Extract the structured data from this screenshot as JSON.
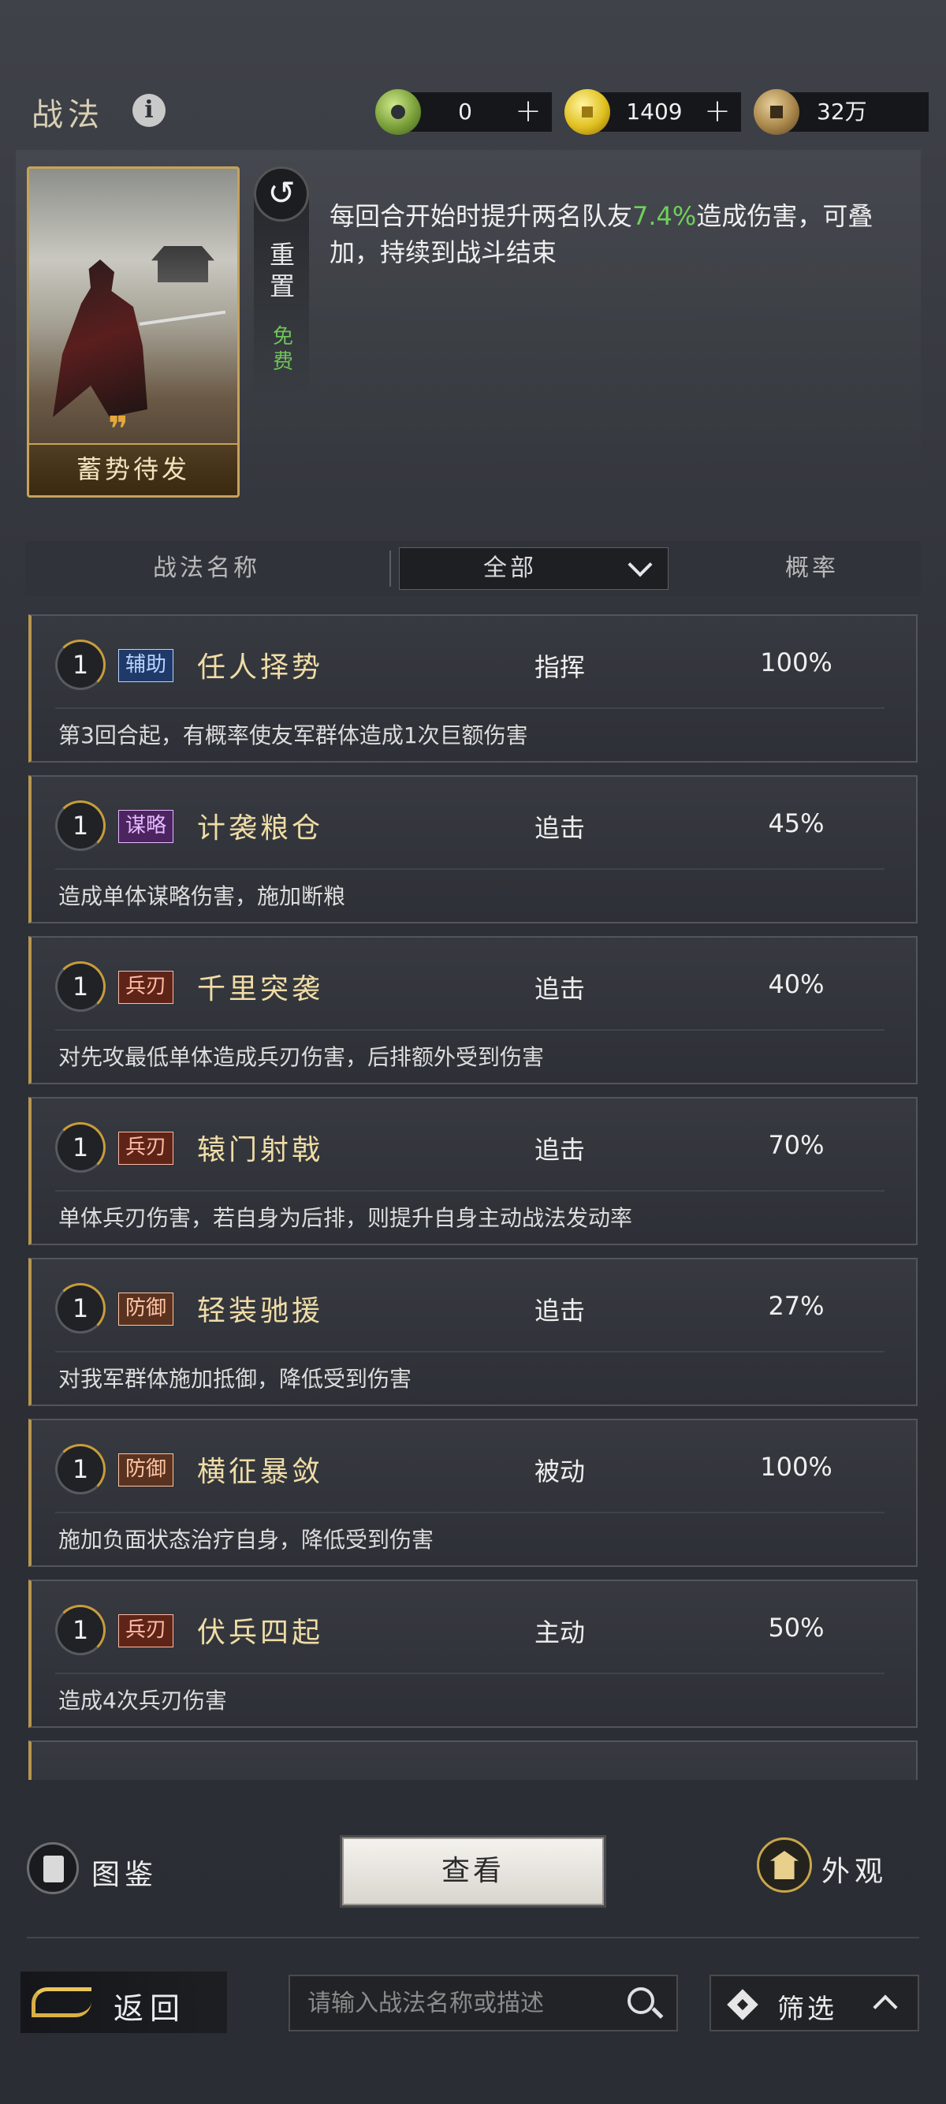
{
  "header": {
    "title": "战法",
    "info_icon": "info-icon",
    "currencies": [
      {
        "icon": "jade-icon",
        "value": "0",
        "plus": "+"
      },
      {
        "icon": "gold-coin-icon",
        "value": "1409",
        "plus": "+"
      },
      {
        "icon": "copper-coin-icon",
        "value": "32万"
      }
    ]
  },
  "selected_skill": {
    "card_name": "蓄势待发",
    "reset_label": "重置",
    "free_label": "免费",
    "desc_pre": "每回合开始时提升两名队友",
    "desc_highlight": "7.4%",
    "desc_post": "造成伤害，可叠加，持续到战斗结束",
    "highlight_color": "#6fd05a"
  },
  "table": {
    "col_name": "战法名称",
    "filter_value": "全部",
    "col_prob": "概率"
  },
  "skills": [
    {
      "level": "1",
      "tag": "辅助",
      "tag_kind": "aux",
      "name": "任人择势",
      "type": "指挥",
      "prob": "100%",
      "desc": "第3回合起，有概率使友军群体造成1次巨额伤害"
    },
    {
      "level": "1",
      "tag": "谋略",
      "tag_kind": "strat",
      "name": "计袭粮仓",
      "type": "追击",
      "prob": "45%",
      "desc": "造成单体谋略伤害，施加断粮"
    },
    {
      "level": "1",
      "tag": "兵刃",
      "tag_kind": "weapon",
      "name": "千里突袭",
      "type": "追击",
      "prob": "40%",
      "desc": "对先攻最低单体造成兵刃伤害，后排额外受到伤害"
    },
    {
      "level": "1",
      "tag": "兵刃",
      "tag_kind": "weapon",
      "name": "辕门射戟",
      "type": "追击",
      "prob": "70%",
      "desc": "单体兵刃伤害，若自身为后排，则提升自身主动战法发动率"
    },
    {
      "level": "1",
      "tag": "防御",
      "tag_kind": "def",
      "name": "轻装驰援",
      "type": "追击",
      "prob": "27%",
      "desc": "对我军群体施加抵御，降低受到伤害"
    },
    {
      "level": "1",
      "tag": "防御",
      "tag_kind": "def",
      "name": "横征暴敛",
      "type": "被动",
      "prob": "100%",
      "desc": "施加负面状态治疗自身，降低受到伤害"
    },
    {
      "level": "1",
      "tag": "兵刃",
      "tag_kind": "weapon",
      "name": "伏兵四起",
      "type": "主动",
      "prob": "50%",
      "desc": "造成4次兵刃伤害"
    }
  ],
  "actions": {
    "gallery_label": "图鉴",
    "view_label": "查看",
    "appearance_label": "外观"
  },
  "footer": {
    "back_label": "返回",
    "search_placeholder": "请输入战法名称或描述",
    "filter_label": "筛选"
  }
}
